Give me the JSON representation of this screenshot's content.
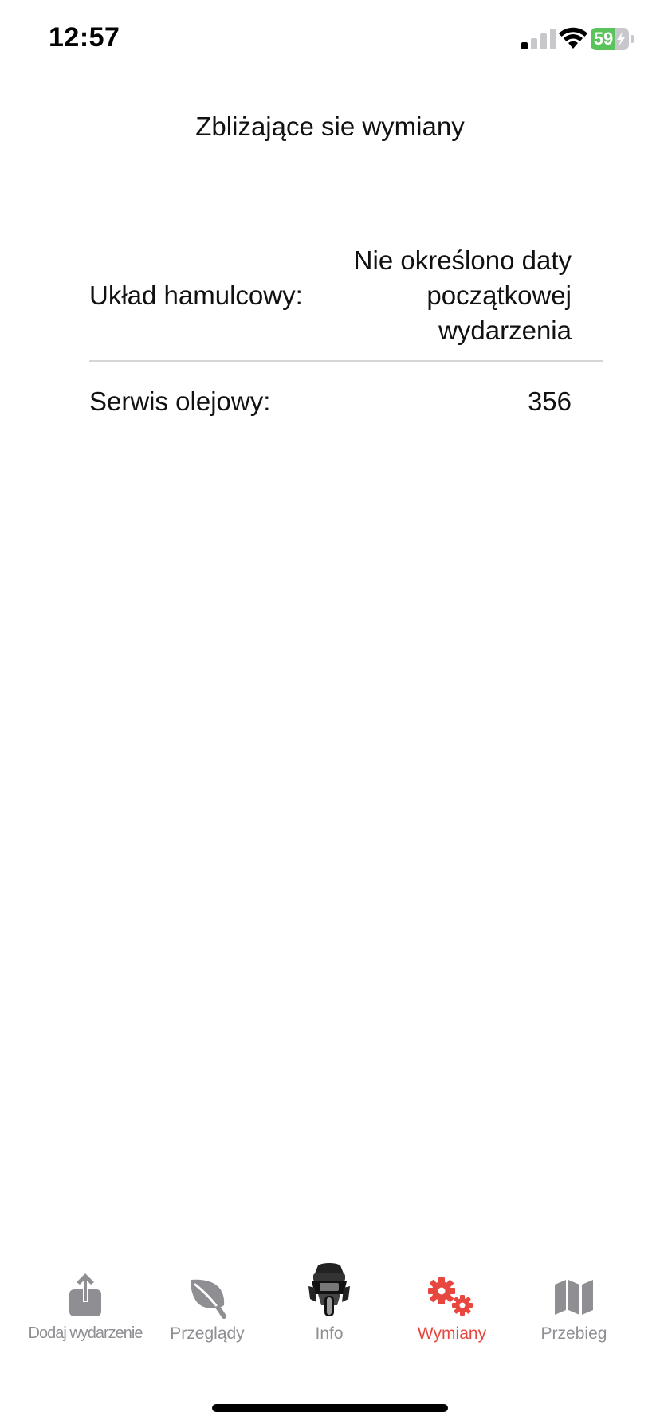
{
  "status_bar": {
    "time": "12:57",
    "battery_level": "59",
    "battery_color": "#5ac35b"
  },
  "page": {
    "title": "Zbliżające sie wymiany"
  },
  "rows": [
    {
      "label": "Układ hamulcowy:",
      "value_lines": [
        "Nie określono daty",
        "początkowej",
        "wydarzenia"
      ]
    },
    {
      "label": "Serwis olejowy:",
      "value": "356"
    }
  ],
  "tab_bar": {
    "active_color": "#e8473f",
    "inactive_color": "#8e8e93",
    "tabs": [
      {
        "label": "Dodaj wydarzenie",
        "icon": "share-upload-icon"
      },
      {
        "label": "Przeglądy",
        "icon": "leaf-icon"
      },
      {
        "label": "Info",
        "icon": "motorcycle-rider-icon"
      },
      {
        "label": "Wymiany",
        "icon": "gears-icon",
        "active": true
      },
      {
        "label": "Przebieg",
        "icon": "map-icon"
      }
    ]
  }
}
